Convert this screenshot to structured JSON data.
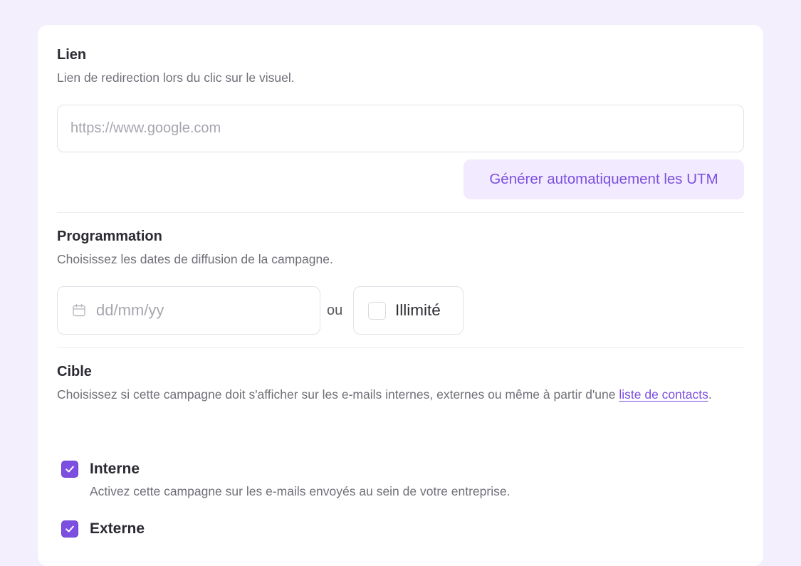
{
  "link_section": {
    "title": "Lien",
    "description": "Lien de redirection lors du clic sur le visuel.",
    "url_placeholder": "https://www.google.com",
    "url_value": "",
    "utm_button_label": "Générer automatiquement les UTM"
  },
  "schedule_section": {
    "title": "Programmation",
    "description": "Choisissez les dates de diffusion de la campagne.",
    "date_placeholder": "dd/mm/yy",
    "or_label": "ou",
    "unlimited_label": "Illimité",
    "unlimited_checked": false
  },
  "target_section": {
    "title": "Cible",
    "description_prefix": "Choisissez si cette campagne doit s'afficher sur les e-mails internes, externes ou même à partir d'une ",
    "description_link": "liste de contacts",
    "description_suffix": ".",
    "options": [
      {
        "label": "Interne",
        "description": "Activez cette campagne sur les e-mails envoyés au sein de votre entreprise.",
        "checked": true
      },
      {
        "label": "Externe",
        "checked": true
      }
    ]
  },
  "colors": {
    "accent": "#7c4fe0",
    "accent_light": "#f2eafe",
    "background": "#f4effd"
  }
}
